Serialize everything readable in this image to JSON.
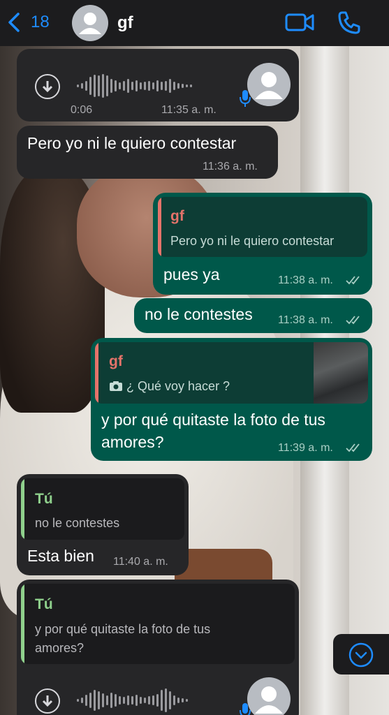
{
  "header": {
    "back_count": "18",
    "contact_name": "gf"
  },
  "messages": {
    "voice1": {
      "duration": "0:06",
      "time": "11:35 a. m."
    },
    "m1": {
      "text": "Pero yo ni le quiero contestar",
      "time": "11:36 a. m."
    },
    "m2": {
      "quote_author": "gf",
      "quote_text": "Pero yo ni le quiero contestar",
      "text": "pues ya",
      "time": "11:38 a. m."
    },
    "m3": {
      "text": "no le contestes",
      "time": "11:38 a. m."
    },
    "m4": {
      "quote_author": "gf",
      "quote_text": "¿ Qué voy hacer ?",
      "text_line1": "y por qué quitaste la foto de tus",
      "text_line2": "amores?",
      "time": "11:39 a. m."
    },
    "m5": {
      "quote_author": "Tú",
      "quote_text": "no le contestes",
      "text": "Esta bien",
      "time": "11:40 a. m."
    },
    "m6": {
      "quote_author": "Tú",
      "quote_text_line1": "y por qué quitaste la foto de tus",
      "quote_text_line2": "amores?"
    }
  },
  "colors": {
    "accent_blue": "#1e8cff",
    "incoming_bubble": "#262628",
    "outgoing_bubble": "#00584a",
    "quote_gf": "#e4736a",
    "quote_tu": "#8fd08c"
  },
  "icons": [
    "back-chevron-icon",
    "video-call-icon",
    "phone-call-icon",
    "download-icon",
    "microphone-icon",
    "camera-icon",
    "read-ticks-icon",
    "scroll-down-icon"
  ]
}
